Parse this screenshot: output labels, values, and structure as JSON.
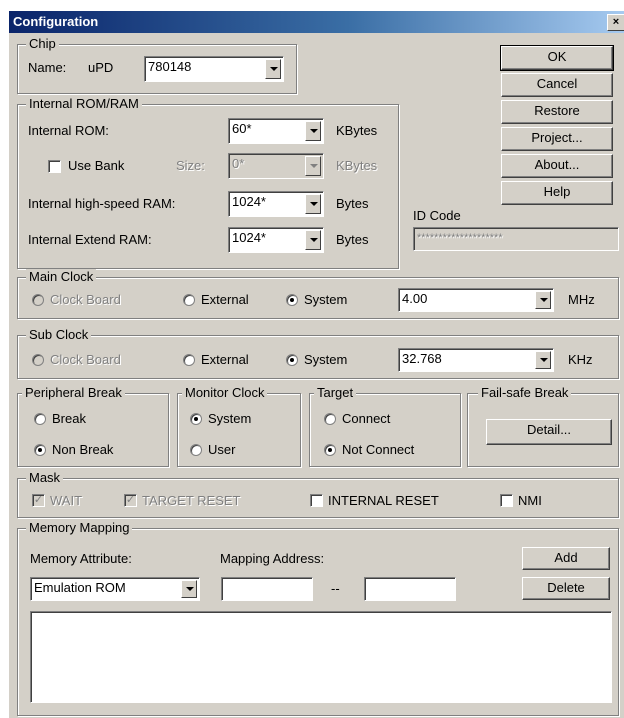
{
  "window": {
    "title": "Configuration",
    "close_glyph": "×"
  },
  "buttons": {
    "ok": "OK",
    "cancel": "Cancel",
    "restore": "Restore",
    "project": "Project...",
    "about": "About...",
    "help": "Help"
  },
  "chip": {
    "legend": "Chip",
    "name_label": "Name:",
    "prefix": "uPD",
    "value": "780148"
  },
  "rom_ram": {
    "legend": "Internal ROM/RAM",
    "rom_label": "Internal ROM:",
    "rom_value": "60*",
    "rom_unit": "KBytes",
    "use_bank_label": "Use Bank",
    "use_bank_checked": false,
    "size_label": "Size:",
    "size_value": "0*",
    "size_unit": "KBytes",
    "hs_ram_label": "Internal high-speed RAM:",
    "hs_ram_value": "1024*",
    "hs_ram_unit": "Bytes",
    "ext_ram_label": "Internal Extend RAM:",
    "ext_ram_value": "1024*",
    "ext_ram_unit": "Bytes"
  },
  "id_code": {
    "legend": "ID Code",
    "value": "********************"
  },
  "main_clock": {
    "legend": "Main Clock",
    "opt_board": "Clock Board",
    "opt_external": "External",
    "opt_system": "System",
    "selected": "System",
    "value": "4.00",
    "unit": "MHz"
  },
  "sub_clock": {
    "legend": "Sub Clock",
    "opt_board": "Clock Board",
    "opt_external": "External",
    "opt_system": "System",
    "selected": "System",
    "value": "32.768",
    "unit": "KHz"
  },
  "peripheral_break": {
    "legend": "Peripheral Break",
    "opt_break": "Break",
    "opt_nonbreak": "Non Break",
    "selected": "Non Break"
  },
  "monitor_clock": {
    "legend": "Monitor Clock",
    "opt_system": "System",
    "opt_user": "User",
    "selected": "System"
  },
  "target": {
    "legend": "Target",
    "opt_connect": "Connect",
    "opt_notconnect": "Not Connect",
    "selected": "Not Connect"
  },
  "failsafe": {
    "legend": "Fail-safe Break",
    "detail_label": "Detail..."
  },
  "mask": {
    "legend": "Mask",
    "wait": "WAIT",
    "target_reset": "TARGET RESET",
    "internal_reset": "INTERNAL RESET",
    "nmi": "NMI",
    "wait_checked": true,
    "target_reset_checked": true,
    "internal_reset_checked": false,
    "nmi_checked": false
  },
  "memory_mapping": {
    "legend": "Memory Mapping",
    "attr_label": "Memory Attribute:",
    "attr_value": "Emulation ROM",
    "addr_label": "Mapping Address:",
    "addr_from": "",
    "separator": "--",
    "addr_to": "",
    "add_label": "Add",
    "delete_label": "Delete"
  }
}
